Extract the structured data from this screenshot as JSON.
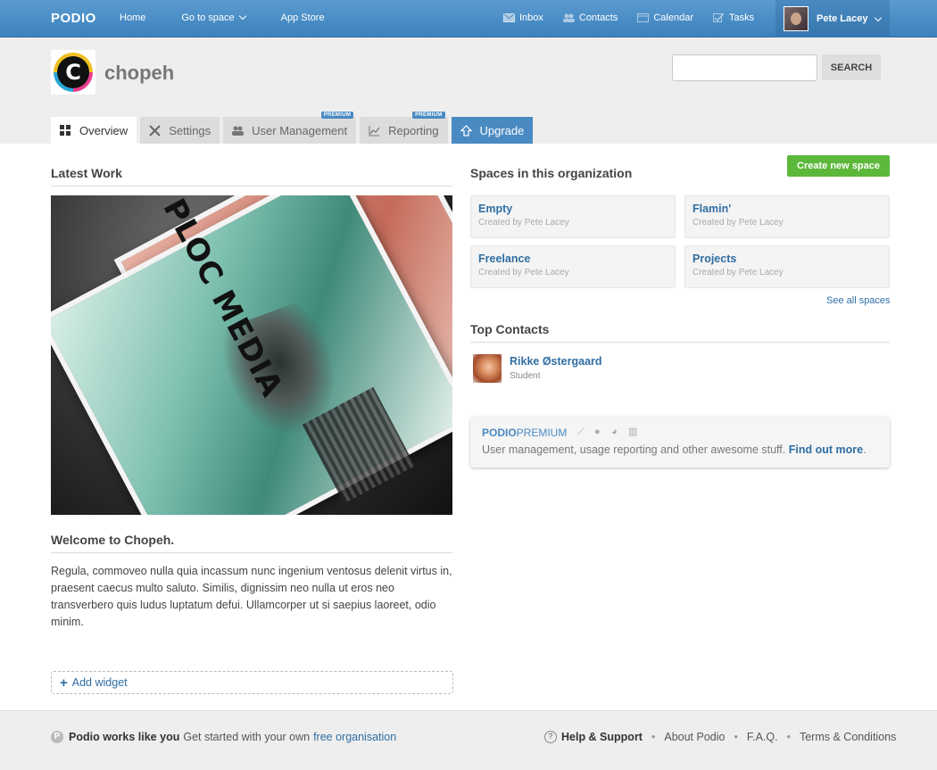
{
  "topbar": {
    "logo": "PODIO",
    "nav_left": [
      "Home",
      "Go to space",
      "App Store"
    ],
    "nav_right": [
      {
        "label": "Inbox",
        "icon": "envelope-icon"
      },
      {
        "label": "Contacts",
        "icon": "contacts-icon"
      },
      {
        "label": "Calendar",
        "icon": "calendar-icon"
      },
      {
        "label": "Tasks",
        "icon": "tasks-icon"
      }
    ],
    "user_name": "Pete Lacey"
  },
  "header": {
    "org_name": "chopeh",
    "search_placeholder": "",
    "search_button": "SEARCH",
    "tabs": [
      {
        "label": "Overview",
        "icon": "grid-icon",
        "active": true
      },
      {
        "label": "Settings",
        "icon": "tools-icon"
      },
      {
        "label": "User Management",
        "icon": "users-icon",
        "badge": "PREMIUM"
      },
      {
        "label": "Reporting",
        "icon": "chart-icon",
        "badge": "PREMIUM"
      },
      {
        "label": "Upgrade",
        "icon": "upgrade-icon"
      }
    ]
  },
  "main": {
    "latest_work_title": "Latest Work",
    "welcome_title": "Welcome to Chopeh.",
    "welcome_text": "Regula, commoveo nulla quia incassum nunc ingenium ventosus delenit virtus in, praesent caecus multo saluto. Similis, dignissim neo nulla ut eros neo transverbero quis ludus luptatum defui. Ullamcorper ut si saepius laoreet, odio minim.",
    "add_widget": "Add widget",
    "artwork_text": "PLOC MEDIA"
  },
  "sidebar": {
    "spaces_title": "Spaces in this organization",
    "create_button": "Create new space",
    "spaces": [
      {
        "name": "Empty",
        "creator": "Created by Pete Lacey"
      },
      {
        "name": "Flamin'",
        "creator": "Created by Pete Lacey"
      },
      {
        "name": "Freelance",
        "creator": "Created by Pete Lacey"
      },
      {
        "name": "Projects",
        "creator": "Created by Pete Lacey"
      }
    ],
    "see_all": "See all spaces",
    "contacts_title": "Top Contacts",
    "contact": {
      "name": "Rikke Østergaard",
      "role": "Student"
    },
    "premium": {
      "logo_bold": "PODIO",
      "logo_lite": "PREMIUM",
      "text": "User management, usage reporting and other awesome stuff.",
      "link": "Find out more",
      "suffix": "."
    }
  },
  "footer": {
    "works_bold": "Podio works like you",
    "works_text": "Get started with your own",
    "works_link": "free organisation",
    "help": "Help & Support",
    "links": [
      "About Podio",
      "F.A.Q.",
      "Terms & Conditions"
    ],
    "separator": "•"
  },
  "colors": {
    "topbar": "#3d82bd",
    "accent": "#2f6ea3",
    "create_button": "#5cb83a"
  }
}
